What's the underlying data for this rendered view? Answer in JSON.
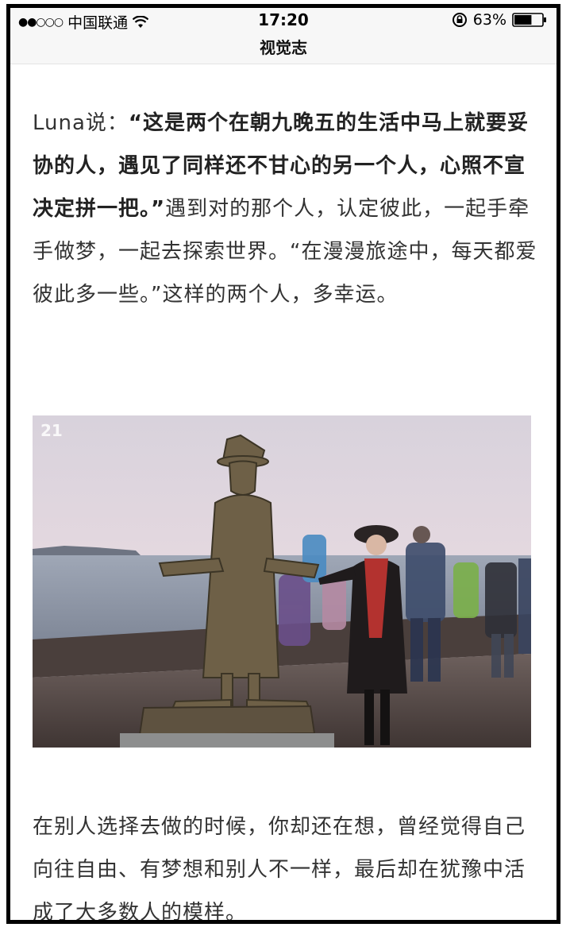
{
  "status_bar": {
    "signal": "●●○○○",
    "carrier": "中国联通",
    "time": "17:20",
    "battery_percent": "63%",
    "battery_level": 0.63,
    "icons": [
      "wifi-icon",
      "rotation-lock-icon",
      "battery-icon"
    ]
  },
  "nav": {
    "title": "视觉志"
  },
  "article": {
    "para1": {
      "prefix": "Luna说：",
      "bold_quote": "“这是两个在朝九晚五的生活中马上就要妥协的人，遇见了同样还不甘心的另一个人，心照不宣决定拼一把。”",
      "rest": "遇到对的那个人，认定彼此，一起手牵手做梦，一起去探索世界。“在漫漫旅途中，每天都爱彼此多一些。”这样的两个人，多幸运。"
    },
    "photo": {
      "watermark": "21"
    },
    "para2": "在别人选择去做的时候，你却还在想，曾经觉得自己向往自由、有梦想和别人不一样，最后却在犹豫中活成了大多数人的模样。"
  },
  "colors": {
    "bar_bg": "#f7f7f7",
    "text": "#333333",
    "frame": "#000000"
  }
}
